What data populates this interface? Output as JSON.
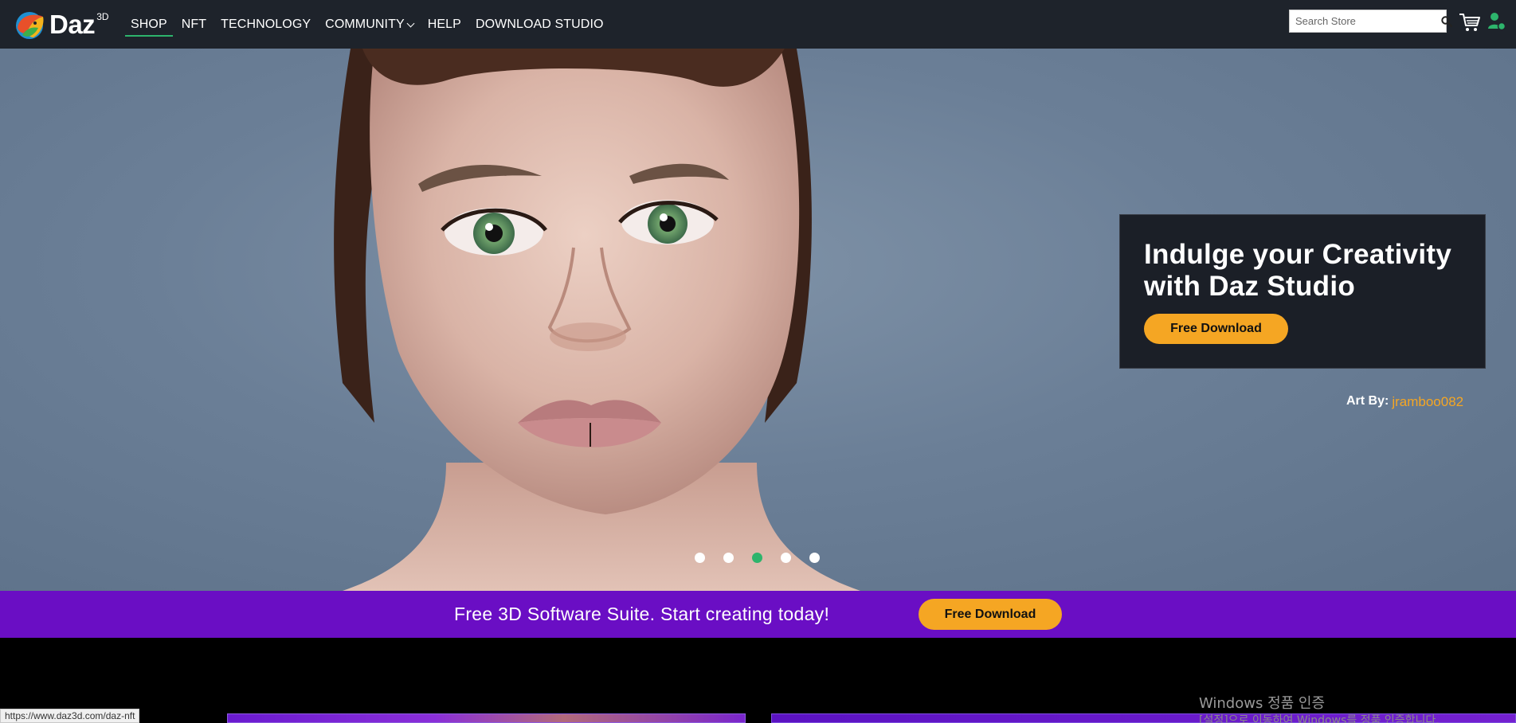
{
  "brand": {
    "name": "Daz",
    "superscript": "3D"
  },
  "nav": {
    "items": [
      {
        "label": "SHOP"
      },
      {
        "label": "NFT"
      },
      {
        "label": "TECHNOLOGY"
      },
      {
        "label": "COMMUNITY"
      },
      {
        "label": "HELP"
      },
      {
        "label": "DOWNLOAD STUDIO"
      }
    ]
  },
  "search": {
    "placeholder": "Search Store",
    "value": ""
  },
  "hero": {
    "promo_title": "Indulge your Creativity with Daz Studio",
    "promo_button": "Free Download",
    "credit_label": "Art By:",
    "credit_author": "jramboo082",
    "slides_total": 5,
    "active_slide": 3
  },
  "banner": {
    "text": "Free 3D Software Suite. Start creating today!",
    "button": "Free Download"
  },
  "windows_notice": {
    "title": "Windows 정품 인증",
    "subtitle": "[설정]으로 이동하여 Windows를 정품 인증합니다."
  },
  "status_bar": {
    "url": "https://www.daz3d.com/daz-nft"
  },
  "colors": {
    "nav_bg": "#1e232b",
    "accent_green": "#2db46c",
    "button_orange": "#f5a623",
    "banner_purple": "#6a0ec4"
  }
}
